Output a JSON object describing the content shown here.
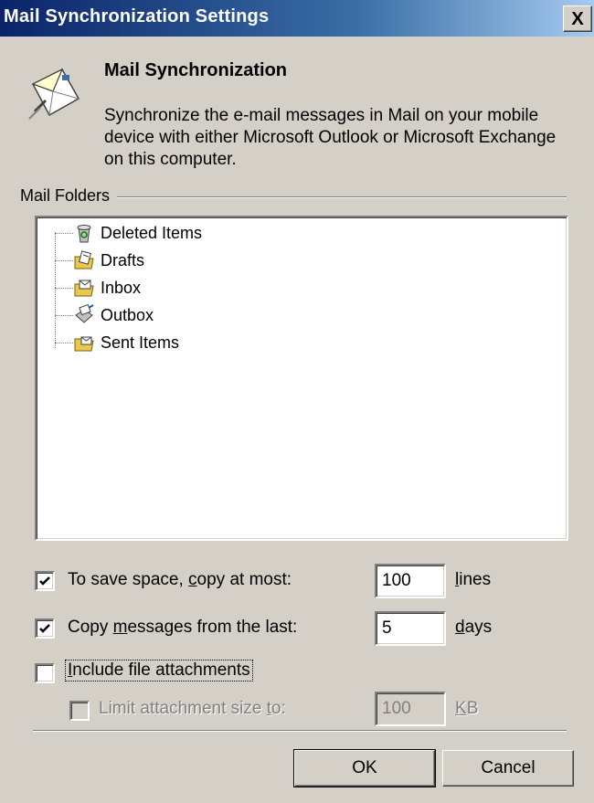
{
  "window": {
    "title": "Mail Synchronization Settings",
    "close_label": "X"
  },
  "header": {
    "heading": "Mail Synchronization",
    "description": "Synchronize the e-mail messages in Mail on your mobile device with either Microsoft Outlook or Microsoft Exchange on this computer."
  },
  "folders": {
    "group_label": "Mail Folders",
    "items": [
      {
        "label": "Deleted Items",
        "icon": "recycle-folder-icon"
      },
      {
        "label": "Drafts",
        "icon": "drafts-folder-icon"
      },
      {
        "label": "Inbox",
        "icon": "inbox-folder-icon"
      },
      {
        "label": "Outbox",
        "icon": "outbox-folder-icon"
      },
      {
        "label": "Sent Items",
        "icon": "sent-folder-icon"
      }
    ]
  },
  "options": {
    "copy_at_most": {
      "checked": true,
      "label_a": "To save space, ",
      "label_u": "c",
      "label_b": "opy at most:",
      "value": "100",
      "unit_u": "l",
      "unit_b": "ines"
    },
    "copy_last": {
      "checked": true,
      "label_a": "Copy ",
      "label_u": "m",
      "label_b": "essages from the last:",
      "value": "5",
      "unit_u": "d",
      "unit_b": "ays"
    },
    "include_attachments": {
      "checked": false,
      "label_u": "I",
      "label_b": "nclude file attachments"
    },
    "limit_size": {
      "checked": false,
      "enabled": false,
      "label_a": "Limit attachment size ",
      "label_u": "t",
      "label_b": "o:",
      "value": "100",
      "unit_u": "K",
      "unit_b": "B"
    }
  },
  "buttons": {
    "ok": "OK",
    "cancel": "Cancel"
  },
  "colors": {
    "title_bar": "#0a246a",
    "dialog_bg": "#d4d0c8"
  }
}
